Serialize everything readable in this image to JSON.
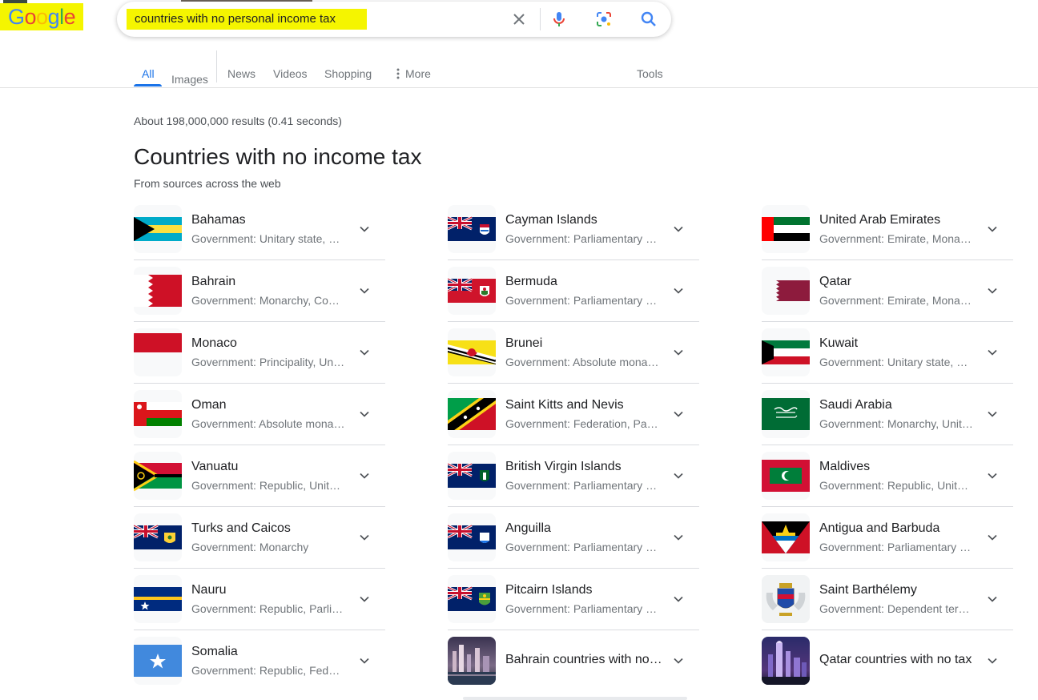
{
  "logo": {
    "letters": [
      "G",
      "o",
      "o",
      "g",
      "l",
      "e"
    ]
  },
  "search": {
    "query": "countries with no personal income tax",
    "clear_icon": "close-icon",
    "voice_icon": "microphone-icon",
    "lens_icon": "camera-lens-icon",
    "submit_icon": "search-icon"
  },
  "tabs": {
    "all": "All",
    "images": "Images",
    "news": "News",
    "videos": "Videos",
    "shopping": "Shopping",
    "more": "More",
    "tools": "Tools"
  },
  "results": {
    "stats": "About 198,000,000 results (0.41 seconds)",
    "heading": "Countries with no income tax",
    "subheading": "From sources across the web"
  },
  "columns": [
    [
      {
        "name": "Bahamas",
        "sub": "Government: Unitary state, Parliamentary system",
        "flag": "bahamas-flag"
      },
      {
        "name": "Bahrain",
        "sub": "Government: Monarchy, Constitutional monarchy",
        "flag": "bahrain-flag"
      },
      {
        "name": "Monaco",
        "sub": "Government: Principality, Unitary state",
        "flag": "monaco-flag"
      },
      {
        "name": "Oman",
        "sub": "Government: Absolute monarchy",
        "flag": "oman-flag"
      },
      {
        "name": "Vanuatu",
        "sub": "Government: Republic, Unitary state",
        "flag": "vanuatu-flag"
      },
      {
        "name": "Turks and Caicos",
        "sub": "Government: Monarchy",
        "flag": "turks-caicos-flag"
      },
      {
        "name": "Nauru",
        "sub": "Government: Republic, Parliamentary system",
        "flag": "nauru-flag"
      },
      {
        "name": "Somalia",
        "sub": "Government: Republic, Federation",
        "flag": "somalia-flag"
      }
    ],
    [
      {
        "name": "Cayman Islands",
        "sub": "Government: Parliamentary system",
        "flag": "cayman-flag"
      },
      {
        "name": "Bermuda",
        "sub": "Government: Parliamentary system",
        "flag": "bermuda-flag"
      },
      {
        "name": "Brunei",
        "sub": "Government: Absolute monarchy",
        "flag": "brunei-flag"
      },
      {
        "name": "Saint Kitts and Nevis",
        "sub": "Government: Federation, Parliamentary system",
        "flag": "saint-kitts-flag"
      },
      {
        "name": "British Virgin Islands",
        "sub": "Government: Parliamentary system",
        "flag": "bvi-flag"
      },
      {
        "name": "Anguilla",
        "sub": "Government: Parliamentary system",
        "flag": "anguilla-flag"
      },
      {
        "name": "Pitcairn Islands",
        "sub": "Government: Parliamentary system",
        "flag": "pitcairn-flag"
      },
      {
        "name": "Bahrain countries with no income tax",
        "sub": "",
        "flag": "bahrain-city-photo"
      }
    ],
    [
      {
        "name": "United Arab Emirates",
        "sub": "Government: Emirate, Monarchy",
        "flag": "uae-flag"
      },
      {
        "name": "Qatar",
        "sub": "Government: Emirate, Monarchy",
        "flag": "qatar-flag"
      },
      {
        "name": "Kuwait",
        "sub": "Government: Unitary state, Monarchy",
        "flag": "kuwait-flag"
      },
      {
        "name": "Saudi Arabia",
        "sub": "Government: Monarchy, Unitary state",
        "flag": "saudi-arabia-flag"
      },
      {
        "name": "Maldives",
        "sub": "Government: Republic, Unitary state",
        "flag": "maldives-flag"
      },
      {
        "name": "Antigua and Barbuda",
        "sub": "Government: Parliamentary system",
        "flag": "antigua-barbuda-flag"
      },
      {
        "name": "Saint Barthélemy",
        "sub": "Government: Dependent territory",
        "flag": "saint-barthelemy-flag"
      },
      {
        "name": "Qatar countries with no tax",
        "sub": "",
        "flag": "qatar-city-photo"
      }
    ]
  ]
}
